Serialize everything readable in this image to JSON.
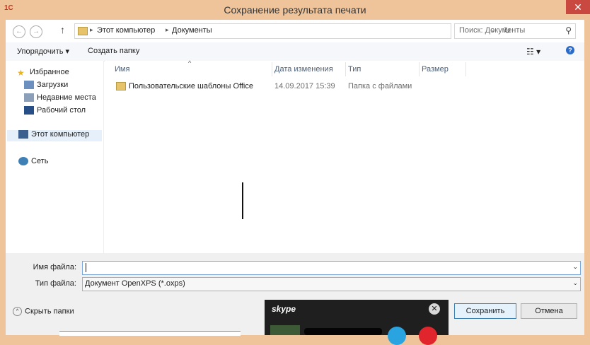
{
  "window": {
    "title": "Сохранение результата печати",
    "close_glyph": "✕",
    "app_icon": "red-app-logo"
  },
  "address": {
    "back_glyph": "←",
    "forward_glyph": "→",
    "up_glyph": "↑",
    "crumbs": [
      "Этот компьютер",
      "Документы"
    ],
    "sep_glyph": "▸",
    "dropdown_glyph": "⌄",
    "refresh_glyph": "↻"
  },
  "search": {
    "placeholder": "Поиск: Документы",
    "icon_glyph": "⚲"
  },
  "toolbar": {
    "organize_label": "Упорядочить",
    "organize_caret": "▾",
    "new_folder_label": "Создать папку",
    "view_glyph": "☷",
    "view_caret": "▾",
    "help_glyph": "?"
  },
  "nav": {
    "favorites": "Избранное",
    "downloads": "Загрузки",
    "recent": "Недавние места",
    "desktop": "Рабочий стол",
    "computer": "Этот компьютер",
    "network": "Сеть"
  },
  "columns": {
    "name": "Имя",
    "date": "Дата изменения",
    "type": "Тип",
    "size": "Размер",
    "sort_glyph": "^"
  },
  "files": [
    {
      "name": "Пользовательские шаблоны Office",
      "date": "14.09.2017 15:39",
      "type": "Папка с файлами",
      "size": ""
    }
  ],
  "form": {
    "filename_label": "Имя файла:",
    "filename_value": "",
    "filetype_label": "Тип файла:",
    "filetype_value": "Документ OpenXPS (*.oxps)",
    "dd_glyph": "⌄"
  },
  "footer": {
    "hide_folders": "Скрыть папки",
    "hide_glyph": "^",
    "save": "Сохранить",
    "cancel": "Отмена"
  },
  "skype": {
    "logo": "skype",
    "close_glyph": "✕"
  }
}
